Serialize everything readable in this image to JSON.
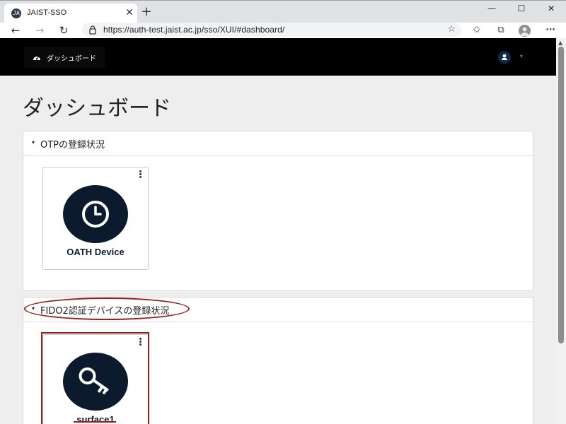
{
  "browser": {
    "tab_title": "JAIST-SSO",
    "tab_favicon_text": "JA",
    "url": "https://auth-test.jaist.ac.jp/sso/XUI/#dashboard/",
    "icons": {
      "tab_close": "✕",
      "new_tab": "+",
      "minimize": "—",
      "maximize": "☐",
      "close": "✕",
      "back": "←",
      "forward": "→",
      "refresh": "↻",
      "favorites_star": "☆",
      "favorites": "✩",
      "collections": "⧉",
      "menu": "⋯"
    }
  },
  "app": {
    "nav_dashboard_label": "ダッシュボード",
    "user_caret": "▾",
    "page_title": "ダッシュボード",
    "colors": {
      "nav_bg": "#000000",
      "card_icon_bg": "#0b1a2c",
      "highlight": "#9c1d1d"
    }
  },
  "sections": {
    "otp": {
      "caret": "▾",
      "title": "OTPの登録状況",
      "device_label": "OATH Device",
      "device_icon": "clock-icon"
    },
    "fido": {
      "caret": "▾",
      "title": "FIDO2認証デバイスの登録状況",
      "device_label": "surface1",
      "device_icon": "key-icon"
    }
  },
  "scrollbar": {
    "up_arrow": "▲"
  }
}
